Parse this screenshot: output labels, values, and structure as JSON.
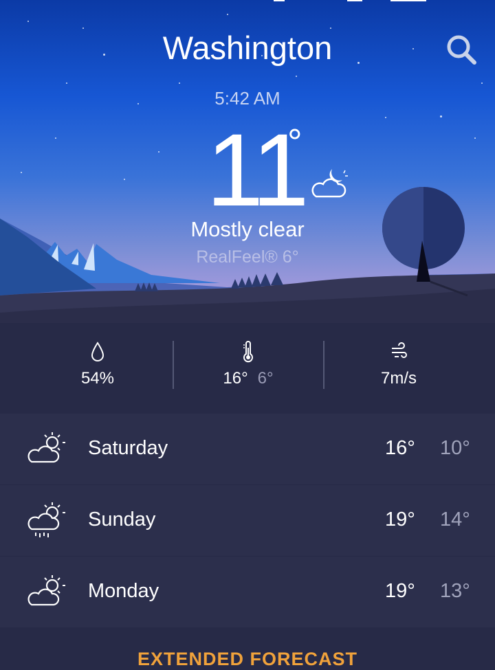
{
  "header": {
    "city": "Washington",
    "search_icon": "search-icon"
  },
  "current": {
    "time": "5:42 AM",
    "temperature": "11",
    "degree_symbol": "°",
    "condition": "Mostly clear",
    "condition_icon": "cloud-moon-icon",
    "realfeel": "RealFeel® 6°"
  },
  "stats": {
    "humidity": {
      "icon": "droplet-icon",
      "value": "54%"
    },
    "temperature_range": {
      "icon": "thermometer-icon",
      "high": "16°",
      "low": "6°"
    },
    "wind": {
      "icon": "wind-icon",
      "value": "7m/s"
    }
  },
  "forecast": [
    {
      "day": "Saturday",
      "high": "16°",
      "low": "10°",
      "icon": "partly-sunny-icon"
    },
    {
      "day": "Sunday",
      "high": "19°",
      "low": "14°",
      "icon": "sun-cloud-rain-icon"
    },
    {
      "day": "Monday",
      "high": "19°",
      "low": "13°",
      "icon": "partly-sunny-icon"
    }
  ],
  "footer": {
    "extended_label": "EXTENDED FORECAST"
  },
  "colors": {
    "accent": "#f0a23b",
    "background": "#272a47",
    "row": "#2c2f4c"
  }
}
